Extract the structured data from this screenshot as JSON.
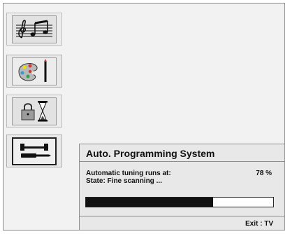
{
  "menu": {
    "items": [
      {
        "name": "sound-menu",
        "icon": "music-notes-icon"
      },
      {
        "name": "picture-menu",
        "icon": "palette-brush-icon"
      },
      {
        "name": "features-menu",
        "icon": "lock-hourglass-icon"
      },
      {
        "name": "install-menu",
        "icon": "wrench-screwdriver-icon",
        "selected": true
      }
    ]
  },
  "dialog": {
    "title": "Auto. Programming System",
    "tuning_label": "Automatic tuning runs at:",
    "tuning_value": "78 %",
    "state_text": "State: Fine scanning ...",
    "progress_fraction": 0.68,
    "exit_text": "Exit : TV"
  },
  "colors": {
    "background": "#f2f2f2",
    "progress_fill": "#111111",
    "progress_track": "#ffffff"
  }
}
